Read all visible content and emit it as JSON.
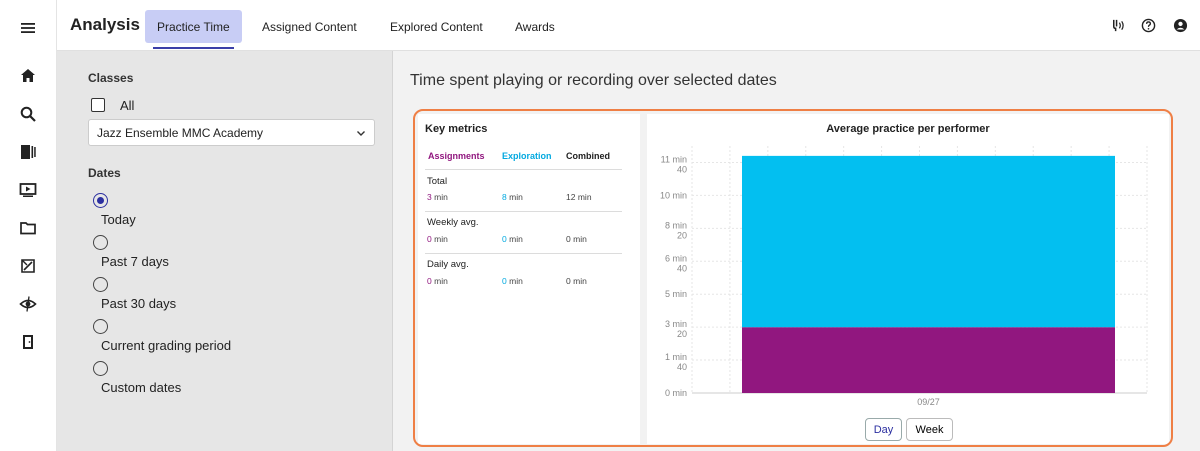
{
  "rail": [
    {
      "name": "menu-icon"
    },
    {
      "name": "home-icon"
    },
    {
      "name": "search-icon"
    },
    {
      "name": "library-icon"
    },
    {
      "name": "video-icon"
    },
    {
      "name": "folder-icon"
    },
    {
      "name": "assignment-icon"
    },
    {
      "name": "eye-icon"
    },
    {
      "name": "exit-icon"
    }
  ],
  "header": {
    "title": "Analysis",
    "tabs": [
      "Practice Time",
      "Assigned Content",
      "Explored Content",
      "Awards"
    ],
    "active_tab": 0,
    "icons": [
      "tuner-icon",
      "help-icon",
      "account-icon"
    ]
  },
  "filters": {
    "classes_label": "Classes",
    "all_label": "All",
    "class_select": "Jazz Ensemble MMC Academy",
    "dates_label": "Dates",
    "date_options": [
      "Today",
      "Past 7 days",
      "Past 30 days",
      "Current grading period",
      "Custom dates"
    ],
    "selected_date": 0
  },
  "main": {
    "title": "Time spent playing or recording over selected dates"
  },
  "metrics": {
    "title": "Key metrics",
    "columns": [
      "Assignments",
      "Exploration",
      "Combined"
    ],
    "rows": [
      {
        "label": "Total",
        "values": [
          "3",
          "8",
          "12"
        ],
        "unit": "min"
      },
      {
        "label": "Weekly avg.",
        "values": [
          "0",
          "0",
          "0"
        ],
        "unit": "min"
      },
      {
        "label": "Daily avg.",
        "values": [
          "0",
          "0",
          "0"
        ],
        "unit": "min"
      }
    ]
  },
  "colors": {
    "assignments": "#91177f",
    "exploration": "#03bff0",
    "accent": "#2b2fa0",
    "highlight": "#ef7f45"
  },
  "chart_data": {
    "type": "bar",
    "title": "Average practice per performer",
    "categories": [
      "09/27"
    ],
    "series": [
      {
        "name": "Assignments",
        "values": [
          3.33
        ]
      },
      {
        "name": "Exploration",
        "values": [
          8.67
        ]
      }
    ],
    "stacked": true,
    "ytick_values": [
      0,
      1.667,
      3.333,
      5,
      6.667,
      8.333,
      10,
      11.667
    ],
    "ytick_labels": [
      "0 min",
      "1 min\n40",
      "3 min\n20",
      "5 min",
      "6 min\n40",
      "8 min\n20",
      "10 min",
      "11 min\n40"
    ],
    "ylim": [
      0,
      12.5
    ],
    "grid": true,
    "toggle": [
      "Day",
      "Week"
    ],
    "toggle_active": 0
  }
}
